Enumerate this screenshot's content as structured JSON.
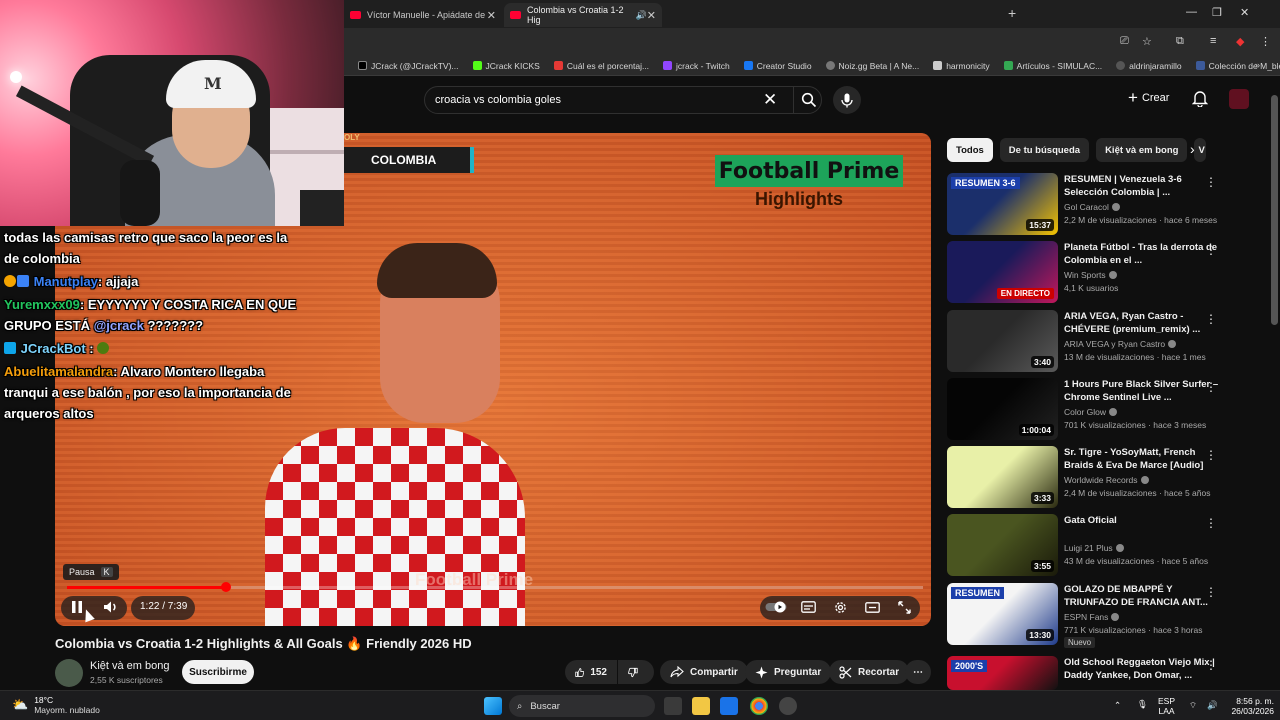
{
  "browser": {
    "tabs": [
      {
        "label": "Víctor Manuelle - Apiádate de"
      },
      {
        "label": "Colombia vs Croatia 1-2 Hig"
      }
    ],
    "new_tab": "+",
    "bookmarks": [
      {
        "label": "JCrack (@JCrackTV)...",
        "icon": "x-icon",
        "color": "#000000"
      },
      {
        "label": "JCrack KICKS",
        "icon": "kick-icon",
        "color": "#53fc18"
      },
      {
        "label": "Cuál es el porcentaj...",
        "icon": "s-icon",
        "color": "#e53935"
      },
      {
        "label": "jcrack - Twitch",
        "icon": "twitch-icon",
        "color": "#9146ff"
      },
      {
        "label": "Creator Studio",
        "icon": "facebook-icon",
        "color": "#1877f2"
      },
      {
        "label": "Noiz.gg Beta | A Ne...",
        "icon": "noiz-icon",
        "color": "#777777"
      },
      {
        "label": "harmonicity",
        "icon": "image-icon",
        "color": "#cccccc"
      },
      {
        "label": "Artículos - SIMULAC...",
        "icon": "drive-icon",
        "color": "#34a853"
      },
      {
        "label": "aldrinjaramillo",
        "icon": "globe-icon",
        "color": "#555555"
      },
      {
        "label": "Colección de M_blei...",
        "icon": "doc-icon",
        "color": "#3c5a9a"
      }
    ],
    "bookmarks_more": "»"
  },
  "youtube_header": {
    "search_query": "croacia vs colombia goles",
    "create_label": "Crear"
  },
  "chat": [
    {
      "user": "",
      "text": "todas las camisas retro que saco la peor es la de colombia",
      "color": "#ffffff"
    },
    {
      "user": "Manutplay",
      "text": ": ajjaja",
      "color": "#3b82f6"
    },
    {
      "user": "Yuremxxx09",
      "text": ": EYYYYYY Y COSTA RICA EN QUE GRUPO ESTÁ ",
      "mention": "@jcrack",
      "text2": " ???????",
      "color": "#22c55e"
    },
    {
      "user": "JCrackBot",
      "text": ":",
      "color": "#7dd3fc"
    },
    {
      "user": "Abuelitamalandra",
      "text": ": Alvaro Montero llegaba tranqui a ese balón , por eso la importancia de arqueros altos",
      "color": "#f59e0b"
    }
  ],
  "video": {
    "overlay_country": "COLOMBIA",
    "overlay_tag": "OLY",
    "brand_line1": "Football Prime",
    "brand_line2": "Highlights",
    "watermark": "Football Prime",
    "tooltip_label": "Pausa",
    "tooltip_key": "K",
    "time_display": "1:22 / 7:39",
    "progress_fraction": 0.186
  },
  "below": {
    "title": "Colombia vs Croatia 1-2 Highlights & All Goals 🔥 Friendly 2026 HD",
    "channel": "Kiệt và em bong",
    "subscribers": "2,55 K suscriptores",
    "subscribe_label": "Suscribirme",
    "likes": "152",
    "share_label": "Compartir",
    "ask_label": "Preguntar",
    "clip_label": "Recortar"
  },
  "sidebar": {
    "chips": [
      "Todos",
      "De tu búsqueda",
      "Kiệt và em bong",
      "V"
    ],
    "recs": [
      {
        "title": "RESUMEN | Venezuela 3-6 Selección Colombia | ...",
        "channel": "Gol Caracol",
        "meta": "2,2 M de visualizaciones · hace 6 meses",
        "duration": "15:37",
        "thumb_text": "RESUMEN 3-6",
        "colors": [
          "#1b2f6b",
          "#f5c400"
        ]
      },
      {
        "title": "Planeta Fútbol - Tras la derrota de Colombia en el ...",
        "channel": "Win Sports",
        "meta": "4,1 K usuarios",
        "duration": "EN DIRECTO",
        "thumb_text": "",
        "colors": [
          "#1a1a5a",
          "#c2185b"
        ]
      },
      {
        "title": "ARIA VEGA, Ryan Castro - CHÉVERE (premium_remix) ...",
        "channel": "ARIA VEGA y Ryan Castro",
        "meta": "13 M de visualizaciones · hace 1 mes",
        "duration": "3:40",
        "thumb_text": "",
        "colors": [
          "#2a2a2a",
          "#5a5a5a"
        ]
      },
      {
        "title": "1 Hours Pure Black Silver Surfer – Chrome Sentinel Live ...",
        "channel": "Color Glow",
        "meta": "701 K visualizaciones · hace 3 meses",
        "duration": "1:00:04",
        "thumb_text": "",
        "colors": [
          "#050505",
          "#222222"
        ]
      },
      {
        "title": "Sr. Tigre - YoSoyMatt, French Braids & Eva De Marce [Audio]",
        "channel": "Worldwide Records",
        "meta": "2,4 M de visualizaciones · hace 5 años",
        "duration": "3:33",
        "thumb_text": "",
        "colors": [
          "#e8f0a8",
          "#2a2a10"
        ]
      },
      {
        "title": "Gata Oficial",
        "channel": "Luigi 21 Plus",
        "meta": "43 M de visualizaciones · hace 5 años",
        "duration": "3:55",
        "thumb_text": "",
        "colors": [
          "#4a5520",
          "#1a1a0a"
        ]
      },
      {
        "title": "GOLAZO DE MBAPPÉ Y TRIUNFAZO DE FRANCIA ANT...",
        "channel": "ESPN Fans",
        "meta": "771 K visualizaciones · hace 3 horas",
        "duration": "13:30",
        "thumb_text": "RESUMEN",
        "badge": "Nuevo",
        "colors": [
          "#f4f4f4",
          "#1e3a8a"
        ]
      },
      {
        "title": "Old School Reggaeton Viejo Mix | Daddy Yankee, Don Omar, ...",
        "channel": "",
        "meta": "",
        "duration": "",
        "thumb_text": "2000'S",
        "colors": [
          "#c8102e",
          "#111111"
        ]
      }
    ]
  },
  "taskbar": {
    "temp": "18°C",
    "weather": "Mayorm. nublado",
    "search_placeholder": "Buscar",
    "lang1": "ESP",
    "lang2": "LAA",
    "time": "8:56 p. m.",
    "date": "26/03/2026"
  }
}
